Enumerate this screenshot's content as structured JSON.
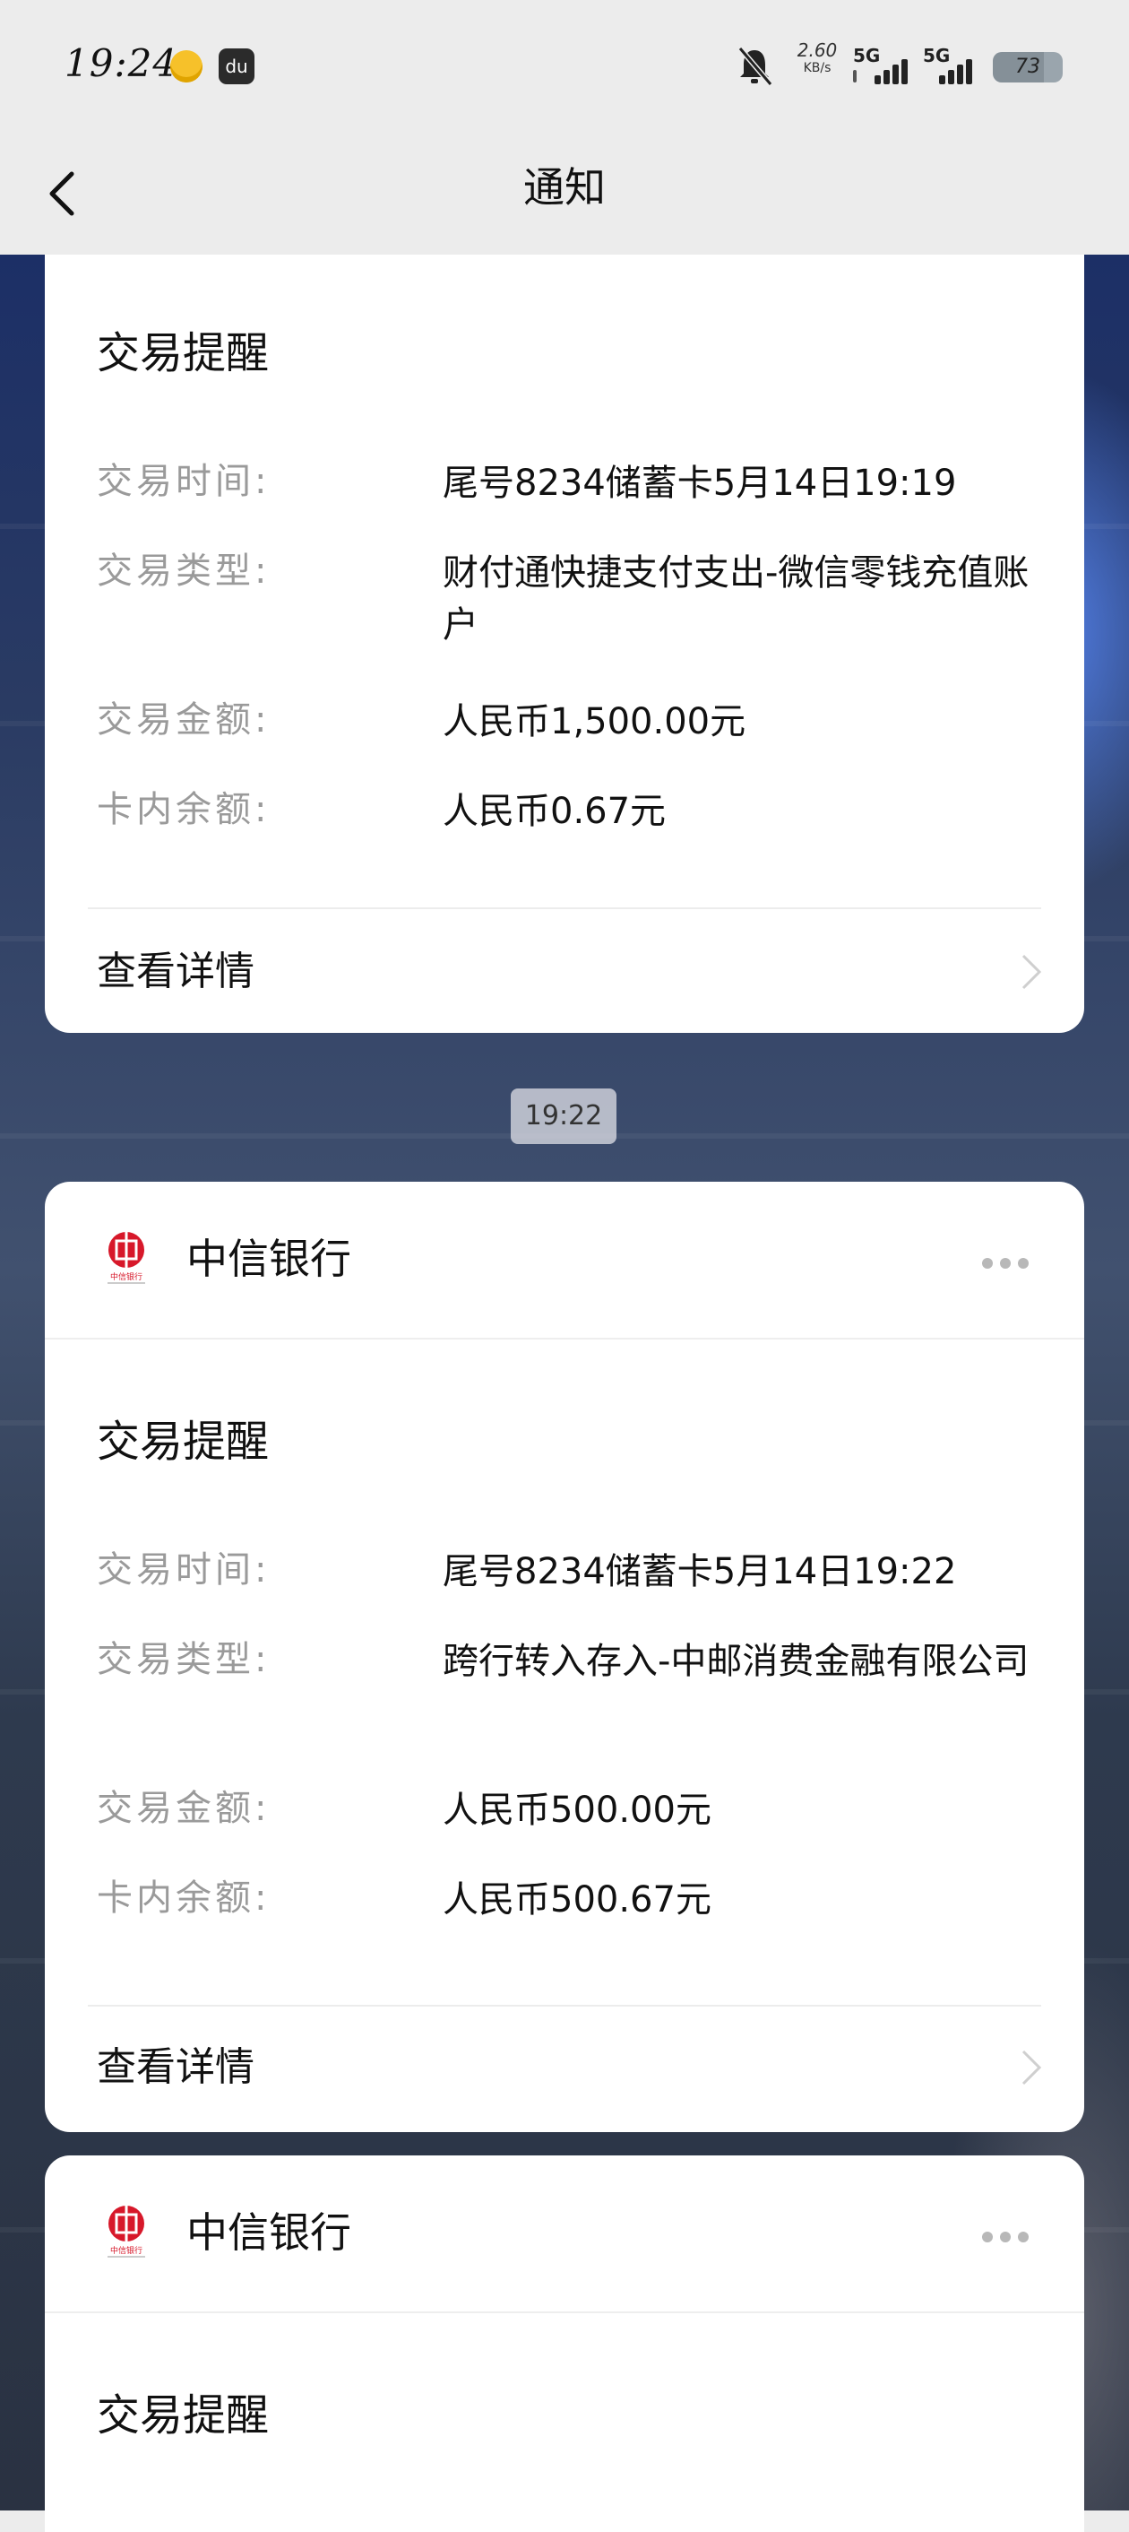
{
  "status_bar": {
    "time": "19:24",
    "net_speed_value": "2.60",
    "net_speed_unit": "KB/s",
    "sim1_label": "5G",
    "sim2_label": "5G",
    "battery": "73",
    "battery_level": 0.73
  },
  "nav": {
    "title": "通知"
  },
  "cards": [
    {
      "title": "交易提醒",
      "rows": [
        {
          "key": "交易时间:",
          "value": "尾号8234储蓄卡5月14日19:19"
        },
        {
          "key": "交易类型:",
          "value": "财付通快捷支付支出-微信零钱充值账户"
        },
        {
          "key": "交易金额:",
          "value": "人民币1,500.00元"
        },
        {
          "key": "卡内余额:",
          "value": "人民币0.67元"
        }
      ],
      "detail": "查看详情"
    },
    {
      "bank": "中信银行",
      "title": "交易提醒",
      "rows": [
        {
          "key": "交易时间:",
          "value": "尾号8234储蓄卡5月14日19:22"
        },
        {
          "key": "交易类型:",
          "value": "跨行转入存入-中邮消费金融有限公司"
        },
        {
          "key": "交易金额:",
          "value": "人民币500.00元"
        },
        {
          "key": "卡内余额:",
          "value": "人民币500.67元"
        }
      ],
      "detail": "查看详情"
    },
    {
      "bank": "中信银行",
      "title": "交易提醒"
    }
  ],
  "time_chip": "19:22",
  "logo_text": "中信银行",
  "colors": {
    "card_bg": "#ffffff",
    "key_text": "#9a9a9a",
    "value_text": "#111111",
    "citic_red": "#d7182a"
  }
}
